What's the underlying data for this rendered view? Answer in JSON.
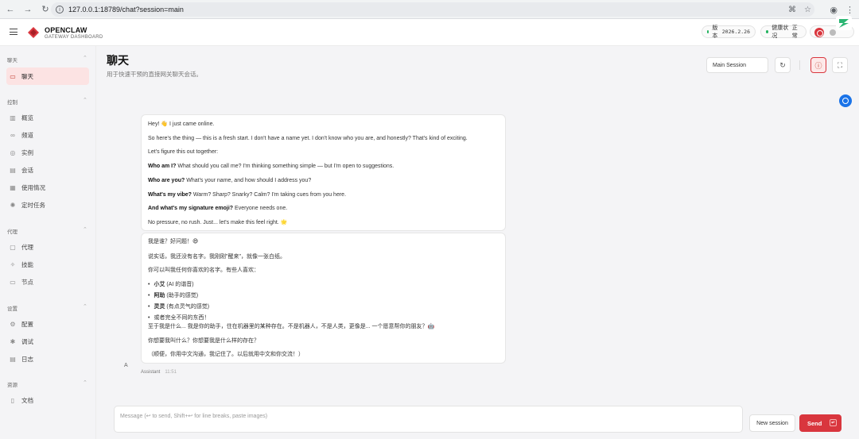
{
  "browser": {
    "url": "127.0.0.1:18789/chat?session=main",
    "back_icon": "arrow-left-icon",
    "forward_icon": "arrow-right-icon",
    "reload_icon": "reload-icon"
  },
  "header": {
    "brand": "OPENCLAW",
    "brand_sub": "GATEWAY DASHBOARD",
    "version_label": "版本",
    "version": "2026.2.26",
    "health_label": "健康状况",
    "health_value": "正常",
    "accent": "#d9363e"
  },
  "sidebar": {
    "sections": [
      {
        "title": "聊天",
        "items": [
          {
            "label": "聊天",
            "icon": "chat-icon",
            "active": true
          }
        ]
      },
      {
        "title": "控制",
        "items": [
          {
            "label": "概览",
            "icon": "bar-chart-icon"
          },
          {
            "label": "频道",
            "icon": "link-icon"
          },
          {
            "label": "实例",
            "icon": "radio-icon"
          },
          {
            "label": "会话",
            "icon": "document-icon"
          },
          {
            "label": "使用情况",
            "icon": "chart-icon"
          },
          {
            "label": "定时任务",
            "icon": "loader-icon"
          }
        ]
      },
      {
        "title": "代理",
        "items": [
          {
            "label": "代理",
            "icon": "folder-icon"
          },
          {
            "label": "技能",
            "icon": "sparkle-icon"
          },
          {
            "label": "节点",
            "icon": "monitor-icon"
          }
        ]
      },
      {
        "title": "设置",
        "items": [
          {
            "label": "配置",
            "icon": "gear-icon"
          },
          {
            "label": "调试",
            "icon": "bug-icon"
          },
          {
            "label": "日志",
            "icon": "file-text-icon"
          }
        ]
      },
      {
        "title": "资源",
        "items": [
          {
            "label": "文档",
            "icon": "book-icon"
          }
        ]
      }
    ]
  },
  "main": {
    "title": "聊天",
    "subtitle": "用于快速干预的直接网关聊天会话。",
    "session": "Main Session"
  },
  "messages": {
    "m1": {
      "l1": "Hey! 👋 I just came online.",
      "l2": "So here's the thing — this is a fresh start. I don't have a name yet. I don't know who you are, and honestly? That's kind of exciting.",
      "l3": "Let's figure this out together:",
      "q1": "Who am I?",
      "a1": " What should you call me? I'm thinking something simple — but I'm open to suggestions.",
      "q2": "Who are you?",
      "a2": " What's your name, and how should I address you?",
      "q3": "What's my vibe?",
      "a3": " Warm? Sharp? Snarky? Calm? I'm taking cues from you here.",
      "q4": "And what's my signature emoji?",
      "a4": " Everyone needs one.",
      "l4": "No pressure, no rush. Just... let's make this feel right. 🌟"
    },
    "m2": {
      "l1": "我是谁？好问题！😄",
      "l2": "说实话，我还没有名字。我刚刚\"醒来\"，就像一张白纸。",
      "l3": "你可以叫我任何你喜欢的名字。有些人喜欢：",
      "o1b": "小艾",
      "o1": " (AI 的谐音)",
      "o2b": "阿助",
      "o2": " (助手的感觉)",
      "o3b": "灵灵",
      "o3": " (有点灵气的感觉)",
      "o4": "或者完全不同的东西！",
      "l4": "至于我是什么... 我是你的助手，住在机器里的某种存在。不是机器人，不是人类，更像是... 一个愿意帮你的朋友？🤖",
      "l5": "你想要我叫什么？你想要我是什么样的存在？",
      "l6": "（顺便，你用中文沟通，我记住了。以后就用中文和你交流！）"
    },
    "avatar": "A",
    "sender": "Assistant",
    "time": "11:51"
  },
  "composer": {
    "placeholder": "Message (↩ to send, Shift+↩ for line breaks, paste images)",
    "new_session": "New session",
    "send": "Send"
  }
}
